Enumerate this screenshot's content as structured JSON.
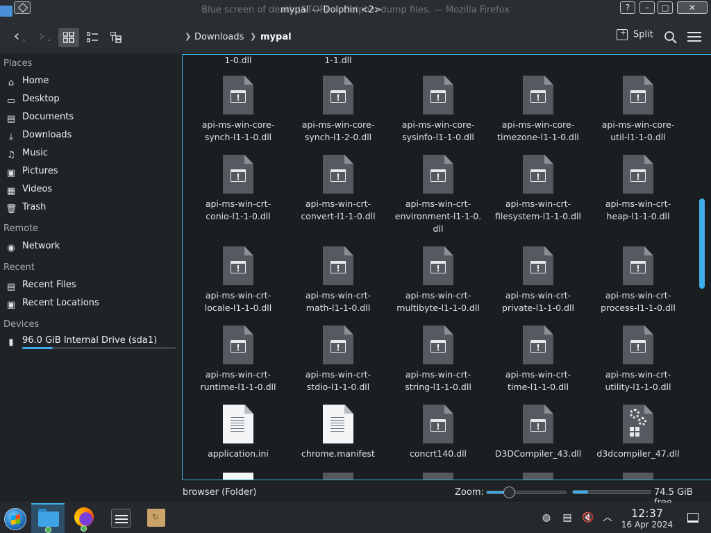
{
  "window": {
    "title_back": "Blue screen of death (STOP) — Dolphin dump files. — Mozilla Firefox",
    "title_front": "mypal — Dolphin <2>"
  },
  "titlebar_buttons": {
    "help": "?",
    "minimize": "–",
    "maximize": "□",
    "close": "✕"
  },
  "toolbar": {
    "breadcrumbs": [
      "Downloads",
      "mypal"
    ],
    "split_label": "Split"
  },
  "sidebar": {
    "places_title": "Places",
    "places": [
      {
        "label": "Home",
        "icon": "home-icon",
        "glyph": "⌂"
      },
      {
        "label": "Desktop",
        "icon": "desktop-icon",
        "glyph": "▭"
      },
      {
        "label": "Documents",
        "icon": "documents-icon",
        "glyph": "▤"
      },
      {
        "label": "Downloads",
        "icon": "downloads-icon",
        "glyph": "⤓"
      },
      {
        "label": "Music",
        "icon": "music-icon",
        "glyph": "♫"
      },
      {
        "label": "Pictures",
        "icon": "pictures-icon",
        "glyph": "▣"
      },
      {
        "label": "Videos",
        "icon": "videos-icon",
        "glyph": "▦"
      },
      {
        "label": "Trash",
        "icon": "trash-icon",
        "glyph": "🗑"
      }
    ],
    "remote_title": "Remote",
    "remote": [
      {
        "label": "Network",
        "icon": "network-icon",
        "glyph": "◉"
      }
    ],
    "recent_title": "Recent",
    "recent": [
      {
        "label": "Recent Files",
        "icon": "recent-files-icon",
        "glyph": "▤"
      },
      {
        "label": "Recent Locations",
        "icon": "recent-locations-icon",
        "glyph": "▣"
      }
    ],
    "devices_title": "Devices",
    "devices": [
      {
        "label": "96.0 GiB Internal Drive (sda1)",
        "icon": "drive-icon",
        "glyph": "▮",
        "usage_fraction": 0.2
      }
    ]
  },
  "files": {
    "partial_top": [
      "1-0.dll",
      "1-1.dll"
    ],
    "rows": [
      [
        {
          "name": "api-ms-win-core-synch-l1-1-0.dll",
          "lines": [
            "api-ms-win-core-",
            "synch-l1-1-0.dll"
          ],
          "kind": "dll"
        },
        {
          "name": "api-ms-win-core-synch-l1-2-0.dll",
          "lines": [
            "api-ms-win-core-",
            "synch-l1-2-0.dll"
          ],
          "kind": "dll"
        },
        {
          "name": "api-ms-win-core-sysinfo-l1-1-0.dll",
          "lines": [
            "api-ms-win-core-",
            "sysinfo-l1-1-0.dll"
          ],
          "kind": "dll"
        },
        {
          "name": "api-ms-win-core-timezone-l1-1-0.dll",
          "lines": [
            "api-ms-win-core-",
            "timezone-l1-1-0.dll"
          ],
          "kind": "dll"
        },
        {
          "name": "api-ms-win-core-util-l1-1-0.dll",
          "lines": [
            "api-ms-win-core-",
            "util-l1-1-0.dll"
          ],
          "kind": "dll"
        }
      ],
      [
        {
          "name": "api-ms-win-crt-conio-l1-1-0.dll",
          "lines": [
            "api-ms-win-crt-",
            "conio-l1-1-0.dll"
          ],
          "kind": "dll"
        },
        {
          "name": "api-ms-win-crt-convert-l1-1-0.dll",
          "lines": [
            "api-ms-win-crt-",
            "convert-l1-1-0.dll"
          ],
          "kind": "dll"
        },
        {
          "name": "api-ms-win-crt-environment-l1-1-0.dll",
          "lines": [
            "api-ms-win-crt-",
            "environment-l1-1-0.",
            "dll"
          ],
          "kind": "dll"
        },
        {
          "name": "api-ms-win-crt-filesystem-l1-1-0.dll",
          "lines": [
            "api-ms-win-crt-",
            "filesystem-l1-1-0.dll"
          ],
          "kind": "dll"
        },
        {
          "name": "api-ms-win-crt-heap-l1-1-0.dll",
          "lines": [
            "api-ms-win-crt-",
            "heap-l1-1-0.dll"
          ],
          "kind": "dll"
        }
      ],
      [
        {
          "name": "api-ms-win-crt-locale-l1-1-0.dll",
          "lines": [
            "api-ms-win-crt-",
            "locale-l1-1-0.dll"
          ],
          "kind": "dll"
        },
        {
          "name": "api-ms-win-crt-math-l1-1-0.dll",
          "lines": [
            "api-ms-win-crt-",
            "math-l1-1-0.dll"
          ],
          "kind": "dll"
        },
        {
          "name": "api-ms-win-crt-multibyte-l1-1-0.dll",
          "lines": [
            "api-ms-win-crt-",
            "multibyte-l1-1-0.dll"
          ],
          "kind": "dll"
        },
        {
          "name": "api-ms-win-crt-private-l1-1-0.dll",
          "lines": [
            "api-ms-win-crt-",
            "private-l1-1-0.dll"
          ],
          "kind": "dll"
        },
        {
          "name": "api-ms-win-crt-process-l1-1-0.dll",
          "lines": [
            "api-ms-win-crt-",
            "process-l1-1-0.dll"
          ],
          "kind": "dll"
        }
      ],
      [
        {
          "name": "api-ms-win-crt-runtime-l1-1-0.dll",
          "lines": [
            "api-ms-win-crt-",
            "runtime-l1-1-0.dll"
          ],
          "kind": "dll"
        },
        {
          "name": "api-ms-win-crt-stdio-l1-1-0.dll",
          "lines": [
            "api-ms-win-crt-",
            "stdio-l1-1-0.dll"
          ],
          "kind": "dll"
        },
        {
          "name": "api-ms-win-crt-string-l1-1-0.dll",
          "lines": [
            "api-ms-win-crt-",
            "string-l1-1-0.dll"
          ],
          "kind": "dll"
        },
        {
          "name": "api-ms-win-crt-time-l1-1-0.dll",
          "lines": [
            "api-ms-win-crt-",
            "time-l1-1-0.dll"
          ],
          "kind": "dll"
        },
        {
          "name": "api-ms-win-crt-utility-l1-1-0.dll",
          "lines": [
            "api-ms-win-crt-",
            "utility-l1-1-0.dll"
          ],
          "kind": "dll"
        }
      ],
      [
        {
          "name": "application.ini",
          "lines": [
            "application.ini"
          ],
          "kind": "text"
        },
        {
          "name": "chrome.manifest",
          "lines": [
            "chrome.manifest"
          ],
          "kind": "text"
        },
        {
          "name": "concrt140.dll",
          "lines": [
            "concrt140.dll"
          ],
          "kind": "dll"
        },
        {
          "name": "D3DCompiler_43.dll",
          "lines": [
            "D3DCompiler_43.dll"
          ],
          "kind": "dll"
        },
        {
          "name": "d3dcompiler_47.dll",
          "lines": [
            "d3dcompiler_47.dll"
          ],
          "kind": "config"
        }
      ]
    ]
  },
  "status": {
    "selection": "browser (Folder)",
    "zoom_label": "Zoom:",
    "zoom_fraction": 0.28,
    "free_space": "74.5 GiB free",
    "free_used_fraction": 0.2
  },
  "taskbar": {
    "clock_time": "12:37",
    "clock_date": "16 Apr 2024"
  },
  "colors": {
    "accent": "#3daee9",
    "background": "#1b1e20",
    "panel": "#2a2e32"
  }
}
